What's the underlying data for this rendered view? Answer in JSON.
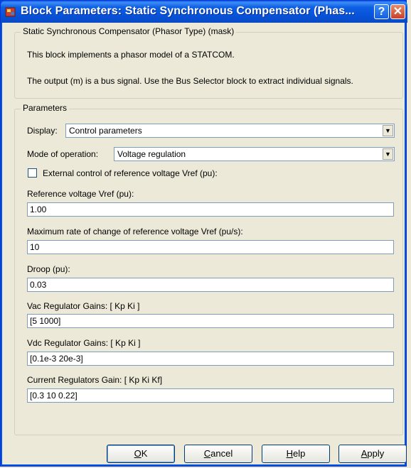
{
  "window": {
    "title": "Block Parameters: Static Synchronous Compensator (Phas...",
    "help_label": "?",
    "close_label": "✕"
  },
  "description": {
    "legend": "Static Synchronous Compensator (Phasor Type) (mask)",
    "line1": "This block implements a phasor model of a STATCOM.",
    "line2": "The output (m) is a bus signal. Use the Bus Selector block to extract individual signals."
  },
  "parameters": {
    "legend": "Parameters",
    "display": {
      "label": "Display:",
      "value": "Control parameters"
    },
    "mode": {
      "label": "Mode of operation:",
      "value": "Voltage regulation"
    },
    "external_control": {
      "label": "External control of reference voltage Vref (pu):",
      "checked": false
    },
    "fields": [
      {
        "label": "Reference voltage Vref (pu):",
        "value": "1.00"
      },
      {
        "label": "Maximum rate of change of reference voltage Vref (pu/s):",
        "value": "10"
      },
      {
        "label": "Droop (pu):",
        "value": "0.03"
      },
      {
        "label": "Vac Regulator Gains: [ Kp  Ki ]",
        "value": "[5 1000]"
      },
      {
        "label": "Vdc Regulator Gains: [ Kp  Ki ]",
        "value": "[0.1e-3 20e-3]"
      },
      {
        "label": "Current Regulators Gain: [ Kp Ki Kf]",
        "value": "[0.3 10 0.22]"
      }
    ]
  },
  "buttons": {
    "ok": {
      "mnemonic": "O",
      "rest": "K"
    },
    "cancel": {
      "mnemonic": "C",
      "rest": "ancel"
    },
    "help": {
      "mnemonic": "H",
      "rest": "elp"
    },
    "apply": {
      "mnemonic": "A",
      "rest": "pply"
    }
  },
  "colors": {
    "titlebar": "#0a5fe6",
    "dialog_bg": "#ece9d8",
    "close_button": "#d55a3e"
  }
}
